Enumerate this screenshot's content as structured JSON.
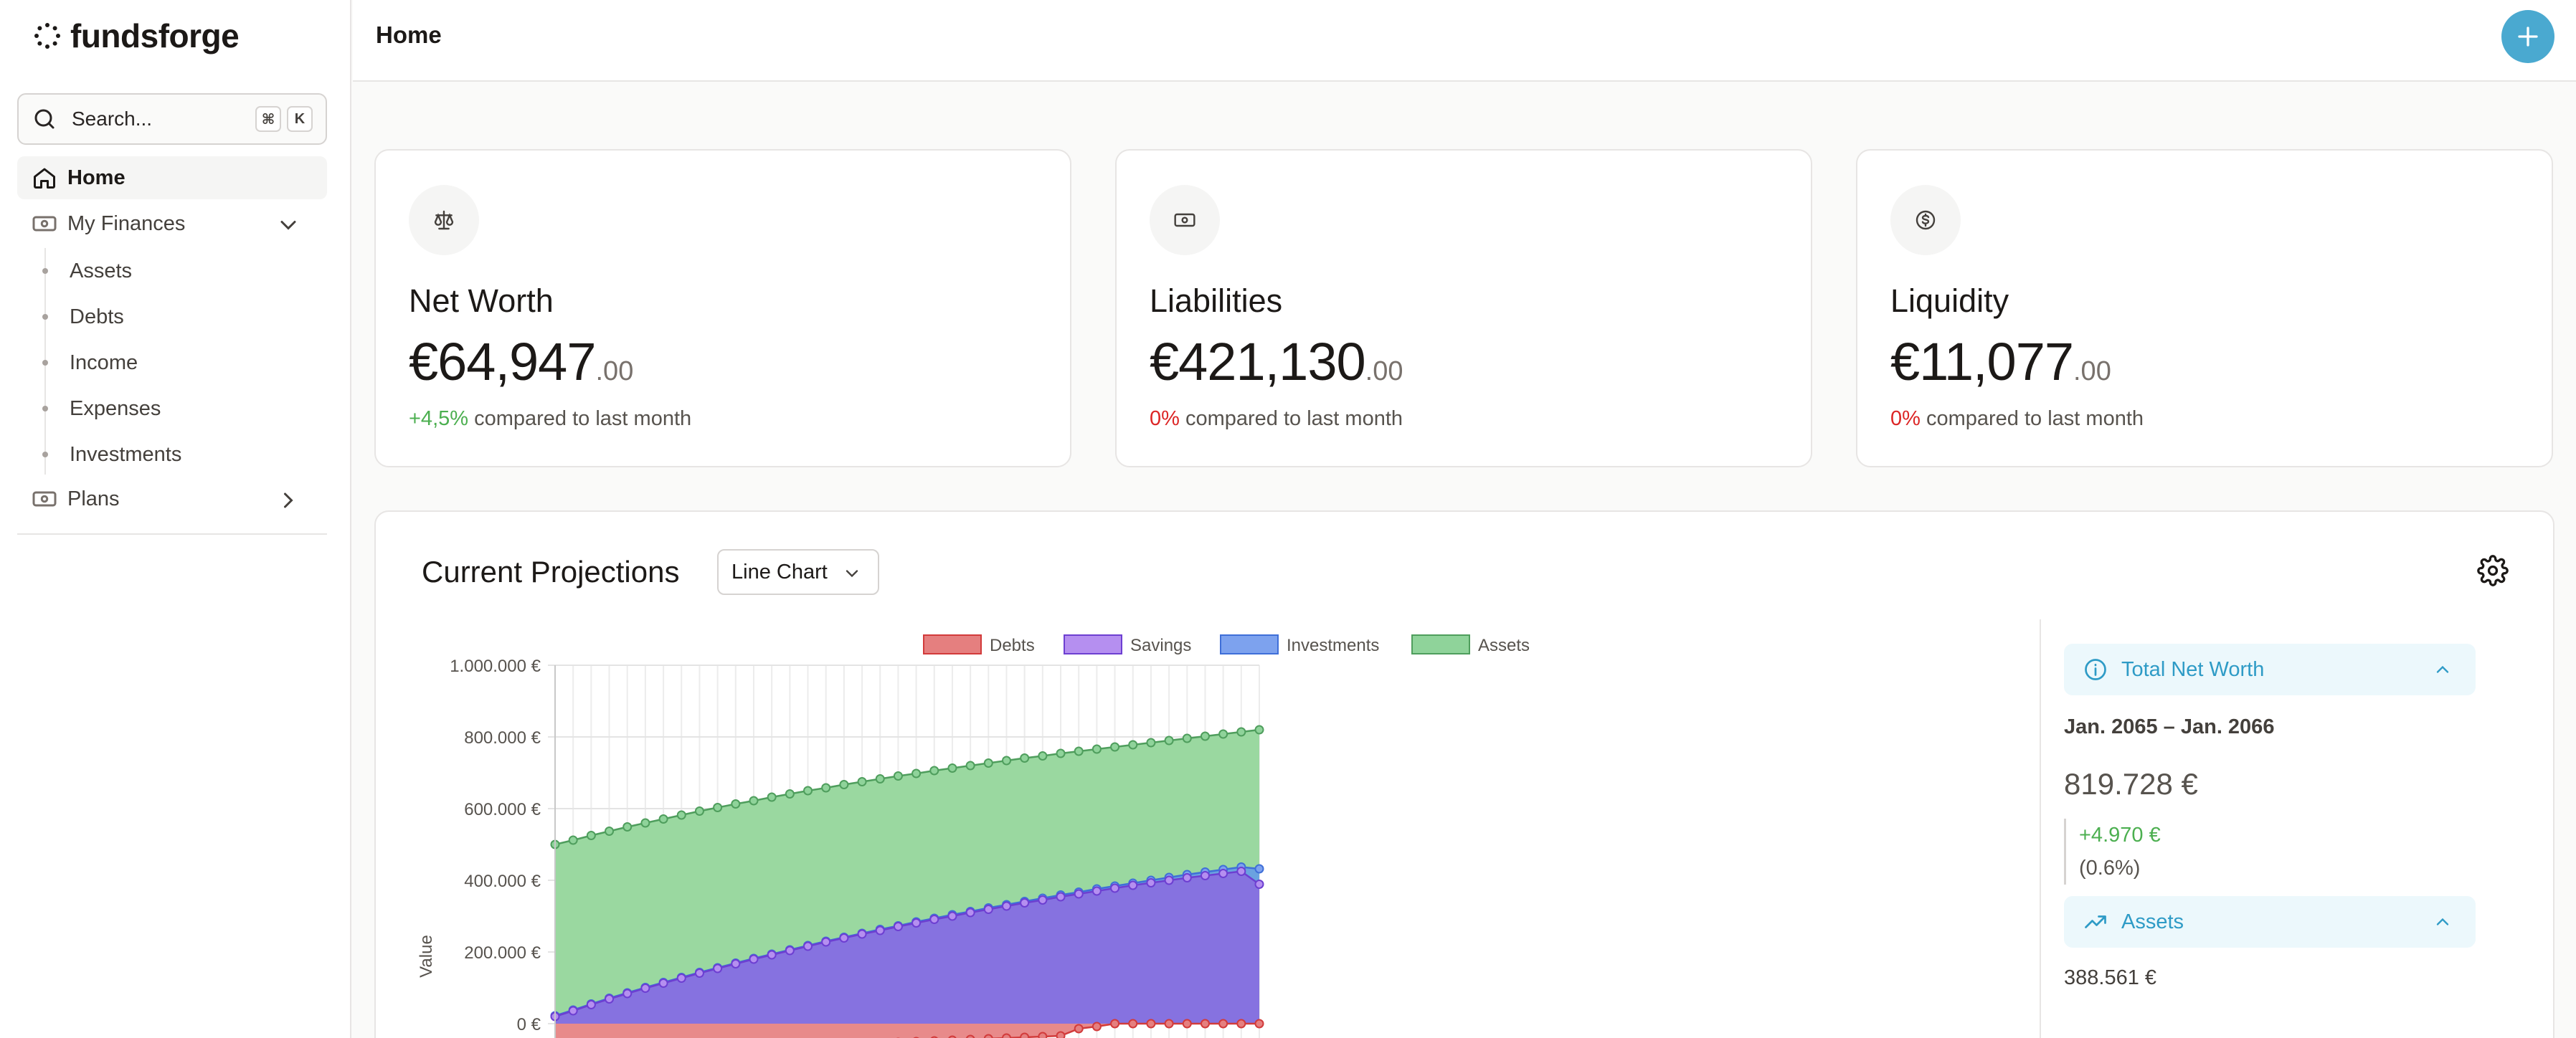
{
  "brand": {
    "name": "fundsforge"
  },
  "search": {
    "placeholder": "Search...",
    "kbd_cmd": "⌘",
    "kbd_key": "K"
  },
  "sidebar": {
    "home": "Home",
    "my_finances": "My Finances",
    "sub_items": [
      "Assets",
      "Debts",
      "Income",
      "Expenses",
      "Investments"
    ],
    "plans": "Plans"
  },
  "header": {
    "title": "Home"
  },
  "stats": [
    {
      "title": "Net Worth",
      "value": "€64,947",
      "cents": ".00",
      "delta": "+4,5%",
      "delta_tone": "up",
      "delta_suffix": " compared to last month"
    },
    {
      "title": "Liabilities",
      "value": "€421,130",
      "cents": ".00",
      "delta": "0%",
      "delta_tone": "zero",
      "delta_suffix": " compared to last month"
    },
    {
      "title": "Liquidity",
      "value": "€11,077",
      "cents": ".00",
      "delta": "0%",
      "delta_tone": "zero",
      "delta_suffix": " compared to last month"
    }
  ],
  "projections": {
    "title": "Current Projections",
    "chart_type_select": "Line Chart",
    "panel": {
      "total_label": "Total Net Worth",
      "range": "Jan. 2065 – Jan. 2066",
      "total_value": "819.728 €",
      "change": "+4.970 €",
      "change_pct": "(0.6%)",
      "assets_label": "Assets",
      "assets_value": "388.561 €"
    }
  },
  "colors": {
    "accent": "#4aa9d0",
    "debts": "#e57f7f",
    "savings": "#b58ff0",
    "investments": "#7da2ee",
    "assets": "#8fd39a"
  },
  "chart_data": {
    "type": "area",
    "title": "",
    "xlabel": "",
    "ylabel": "Value",
    "ylim": [
      0,
      1000000
    ],
    "y_ticks": [
      "1.000.000 €",
      "800.000 €",
      "600.000 €",
      "400.000 €",
      "200.000 €",
      "0 €"
    ],
    "y_tick_values": [
      1000000,
      800000,
      600000,
      400000,
      200000,
      0
    ],
    "legend": [
      "Debts",
      "Savings",
      "Investments",
      "Assets"
    ],
    "legend_position": "top",
    "grid": true,
    "series": [
      {
        "name": "Assets",
        "values": [
          500000,
          512000,
          525000,
          537000,
          549000,
          560000,
          571000,
          582000,
          593000,
          603000,
          613000,
          622000,
          632000,
          641000,
          650000,
          658000,
          667000,
          675000,
          683000,
          691000,
          698000,
          706000,
          713000,
          720000,
          727000,
          734000,
          741000,
          747000,
          754000,
          760000,
          766000,
          772000,
          778000,
          784000,
          790000,
          796000,
          802000,
          808000,
          814000,
          820000
        ]
      },
      {
        "name": "Investments",
        "values": [
          22000,
          38000,
          55000,
          71000,
          86000,
          101000,
          115000,
          129000,
          143000,
          156000,
          169000,
          182000,
          194000,
          206000,
          218000,
          230000,
          241000,
          252000,
          263000,
          273000,
          284000,
          294000,
          304000,
          313000,
          323000,
          332000,
          341000,
          350000,
          359000,
          367000,
          376000,
          384000,
          392000,
          400000,
          408000,
          416000,
          423000,
          430000,
          437000,
          432000
        ]
      },
      {
        "name": "Savings",
        "values": [
          20000,
          36000,
          53000,
          69000,
          84000,
          99000,
          113000,
          127000,
          141000,
          154000,
          167000,
          180000,
          192000,
          204000,
          216000,
          228000,
          239000,
          250000,
          260000,
          271000,
          281000,
          291000,
          300000,
          310000,
          319000,
          328000,
          337000,
          345000,
          354000,
          362000,
          370000,
          378000,
          386000,
          393000,
          400000,
          407000,
          413000,
          419000,
          425000,
          389000
        ]
      },
      {
        "name": "Debts",
        "values": [
          -90000,
          -88000,
          -86000,
          -84000,
          -82000,
          -80000,
          -78000,
          -76000,
          -74000,
          -72000,
          -70000,
          -68000,
          -66000,
          -64000,
          -62000,
          -60000,
          -58000,
          -56000,
          -54000,
          -52000,
          -50000,
          -48000,
          -46000,
          -44000,
          -42000,
          -40000,
          -38000,
          -36000,
          -34000,
          -14000,
          -8000,
          0,
          0,
          0,
          0,
          0,
          0,
          0,
          0,
          0
        ]
      }
    ]
  }
}
